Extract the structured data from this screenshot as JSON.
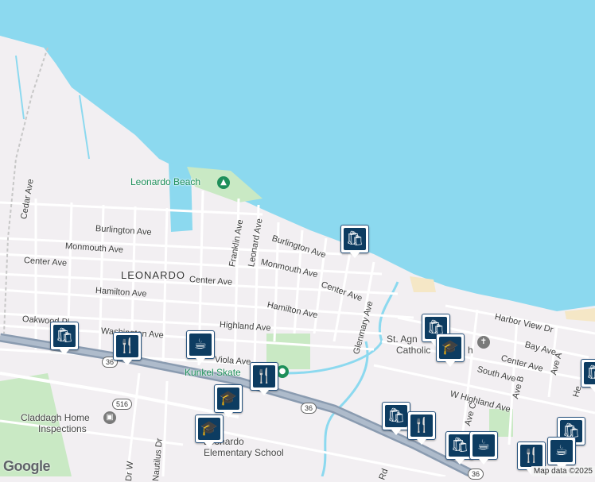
{
  "map": {
    "colors": {
      "water": "#8cd9ef",
      "land": "#f2eff2",
      "road": "#ffffff",
      "highway": "#8a9bb0",
      "park": "#c9e9c4",
      "beach": "#f5e7c6"
    },
    "area_label": "LEONARDO",
    "water_label_beach": "Leonardo Beach",
    "streets": [
      "Cedar Ave",
      "Burlington Ave",
      "Monmouth Ave",
      "Center Ave",
      "Hamilton Ave",
      "Oakwood Pl",
      "Washington Ave",
      "Franklin Ave",
      "Leonard Ave",
      "Burlington Ave",
      "Monmouth Ave",
      "Center Ave",
      "Center Ave",
      "Hamilton Ave",
      "Highland Ave",
      "Viola Ave",
      "Glenmary Ave",
      "Harbor View Dr",
      "Bay Ave",
      "Center Ave",
      "South Ave",
      "W Highland Ave",
      "Ave A",
      "Ave B",
      "Ave C",
      "Nautilus Dr",
      "Dr W",
      "Rd",
      "He"
    ],
    "pois": {
      "skatepark": "Kunkel Skate",
      "church": "St. Agnes Catholic Church",
      "church_line1": "St. Agn",
      "church_line2": "Catholic",
      "church_line3": "h",
      "inspections_line1": "Claddagh Home",
      "inspections_line2": "Inspections",
      "school_line1": "Leonardo",
      "school_line2": "Elementary School"
    },
    "route_shields": [
      "36",
      "516",
      "36",
      "36"
    ],
    "logo": "Google",
    "attribution": "Map data ©2025",
    "markers": [
      {
        "type": "shopping",
        "icon": "shopping-bag-icon"
      },
      {
        "type": "shopping",
        "icon": "shopping-bag-icon"
      },
      {
        "type": "restaurant",
        "icon": "fork-knife-icon"
      },
      {
        "type": "cafe",
        "icon": "coffee-cup-icon"
      },
      {
        "type": "restaurant",
        "icon": "fork-knife-icon"
      },
      {
        "type": "school",
        "icon": "graduation-cap-icon"
      },
      {
        "type": "school",
        "icon": "graduation-cap-icon"
      },
      {
        "type": "shopping",
        "icon": "shopping-bag-icon"
      },
      {
        "type": "school",
        "icon": "graduation-cap-icon"
      },
      {
        "type": "shopping",
        "icon": "shopping-bag-icon"
      },
      {
        "type": "restaurant",
        "icon": "fork-knife-icon"
      },
      {
        "type": "cafe",
        "icon": "coffee-cup-icon"
      },
      {
        "type": "shopping",
        "icon": "shopping-cart-icon"
      }
    ]
  }
}
